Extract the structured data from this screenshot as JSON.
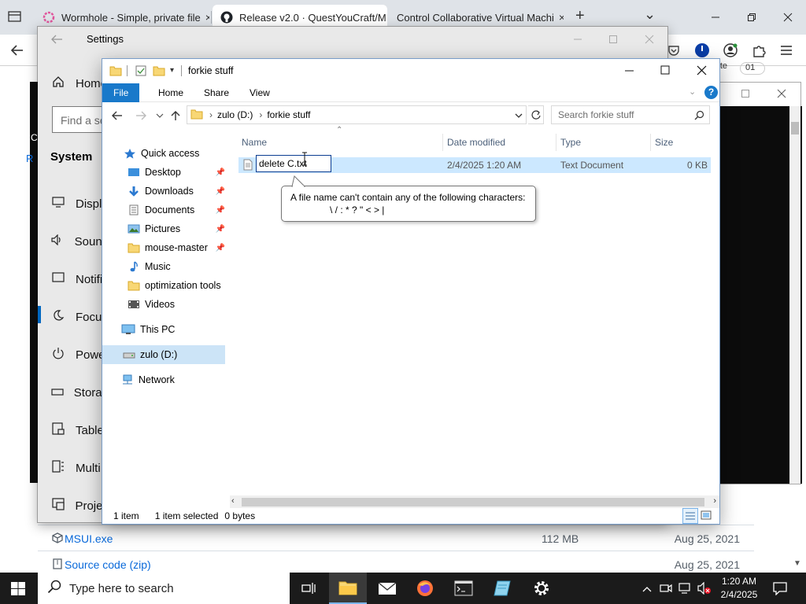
{
  "browser": {
    "tabs": [
      {
        "title": "Wormhole - Simple, private file"
      },
      {
        "title": "Release v2.0 · QuestYouCraft/M"
      },
      {
        "title": "Control Collaborative Virtual Machi"
      }
    ],
    "new_tab": "+",
    "dropdown": "⌄",
    "close": "×"
  },
  "github": {
    "partial_text": "Vote",
    "partial_count": "01",
    "assets": [
      {
        "name": "MSUI.exe",
        "size": "112 MB",
        "date": "Aug 25, 2021"
      },
      {
        "name": "Source code (zip)",
        "size": "",
        "date": "Aug 25, 2021"
      }
    ]
  },
  "settings": {
    "title": "Settings",
    "home": "Home",
    "find_placeholder": "Find a se",
    "section": "System",
    "nav": [
      "Displa",
      "Sound",
      "Notifi",
      "Focus",
      "Powe",
      "Storag",
      "Table",
      "Multi",
      "Projec"
    ],
    "left_fragments": [
      "C",
      "R"
    ]
  },
  "explorer": {
    "title": "forkie stuff",
    "ribbon_tabs": [
      "File",
      "Home",
      "Share",
      "View"
    ],
    "breadcrumb": [
      "zulo (D:)",
      "forkie stuff"
    ],
    "search_placeholder": "Search forkie stuff",
    "nav_pane": {
      "quick_access": "Quick access",
      "pinned": [
        "Desktop",
        "Downloads",
        "Documents",
        "Pictures",
        "mouse-master"
      ],
      "unpinned": [
        "Music",
        "optimization tools",
        "Videos"
      ],
      "this_pc": "This PC",
      "drive": "zulo (D:)",
      "network": "Network"
    },
    "columns": [
      "Name",
      "Date modified",
      "Type",
      "Size"
    ],
    "files": [
      {
        "name": "delete C.txt",
        "date": "2/4/2025 1:20 AM",
        "type": "Text Document",
        "size": "0 KB"
      }
    ],
    "rename_value": "delete C.txt",
    "tooltip": {
      "line1": "A file name can't contain any of the following characters:",
      "line2": "\\ / : * ? \" < > |"
    },
    "status": {
      "count": "1 item",
      "selected": "1 item selected",
      "bytes": "0 bytes"
    }
  },
  "taskbar": {
    "search_placeholder": "Type here to search",
    "time": "1:20 AM",
    "date": "2/4/2025"
  }
}
